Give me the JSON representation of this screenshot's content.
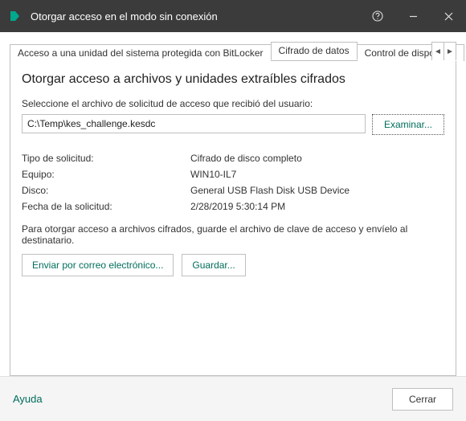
{
  "window": {
    "title": "Otorgar acceso en el modo sin conexión"
  },
  "tabs": {
    "bitlocker": "Acceso a una unidad del sistema protegida con BitLocker",
    "cifrado": "Cifrado de datos",
    "control": "Control de dispositivo"
  },
  "panel": {
    "heading": "Otorgar acceso a archivos y unidades extraíbles cifrados",
    "instruction": "Seleccione el archivo de solicitud de acceso que recibió del usuario:",
    "file_value": "C:\\Temp\\kes_challenge.kesdc",
    "browse_label": "Examinar...",
    "details": {
      "type_label": "Tipo de solicitud:",
      "type_value": "Cifrado de disco completo",
      "host_label": "Equipo:",
      "host_value": "WIN10-IL7",
      "disk_label": "Disco:",
      "disk_value": "General USB Flash Disk USB Device",
      "date_label": "Fecha de la solicitud:",
      "date_value": "2/28/2019 5:30:14 PM"
    },
    "paragraph": "Para otorgar acceso a archivos cifrados, guarde el archivo de clave de acceso y envíelo al destinatario.",
    "email_button": "Enviar por correo electrónico...",
    "save_button": "Guardar..."
  },
  "footer": {
    "help": "Ayuda",
    "close": "Cerrar"
  }
}
